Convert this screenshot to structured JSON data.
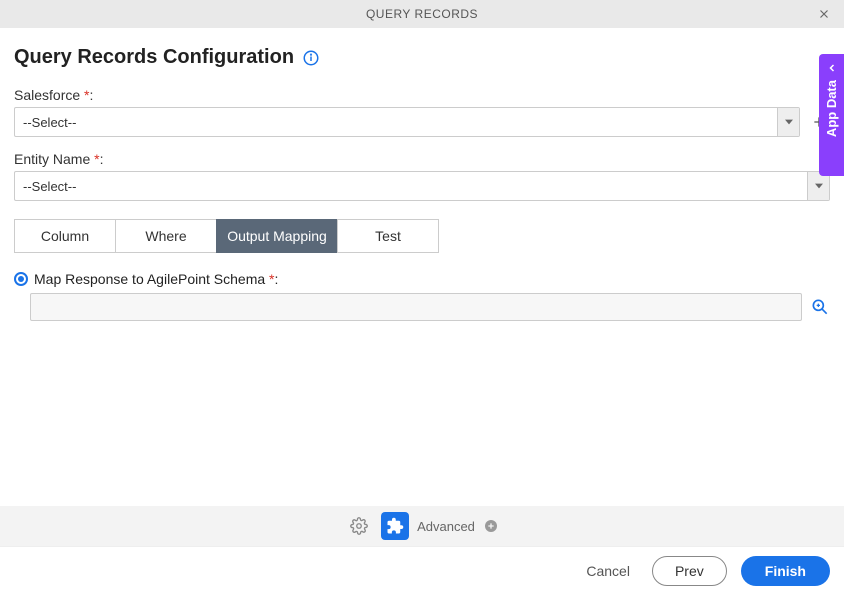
{
  "header": {
    "title": "QUERY RECORDS"
  },
  "page": {
    "title": "Query Records Configuration"
  },
  "fields": {
    "salesforce": {
      "label": "Salesforce",
      "value": "--Select--"
    },
    "entity": {
      "label": "Entity Name",
      "value": "--Select--"
    }
  },
  "tabs": {
    "column": "Column",
    "where": "Where",
    "output_mapping": "Output Mapping",
    "test": "Test"
  },
  "output": {
    "map_label": "Map Response to AgilePoint Schema",
    "schema_value": ""
  },
  "advanced": {
    "label": "Advanced"
  },
  "footer": {
    "cancel": "Cancel",
    "prev": "Prev",
    "finish": "Finish"
  },
  "side": {
    "label": "App Data"
  }
}
